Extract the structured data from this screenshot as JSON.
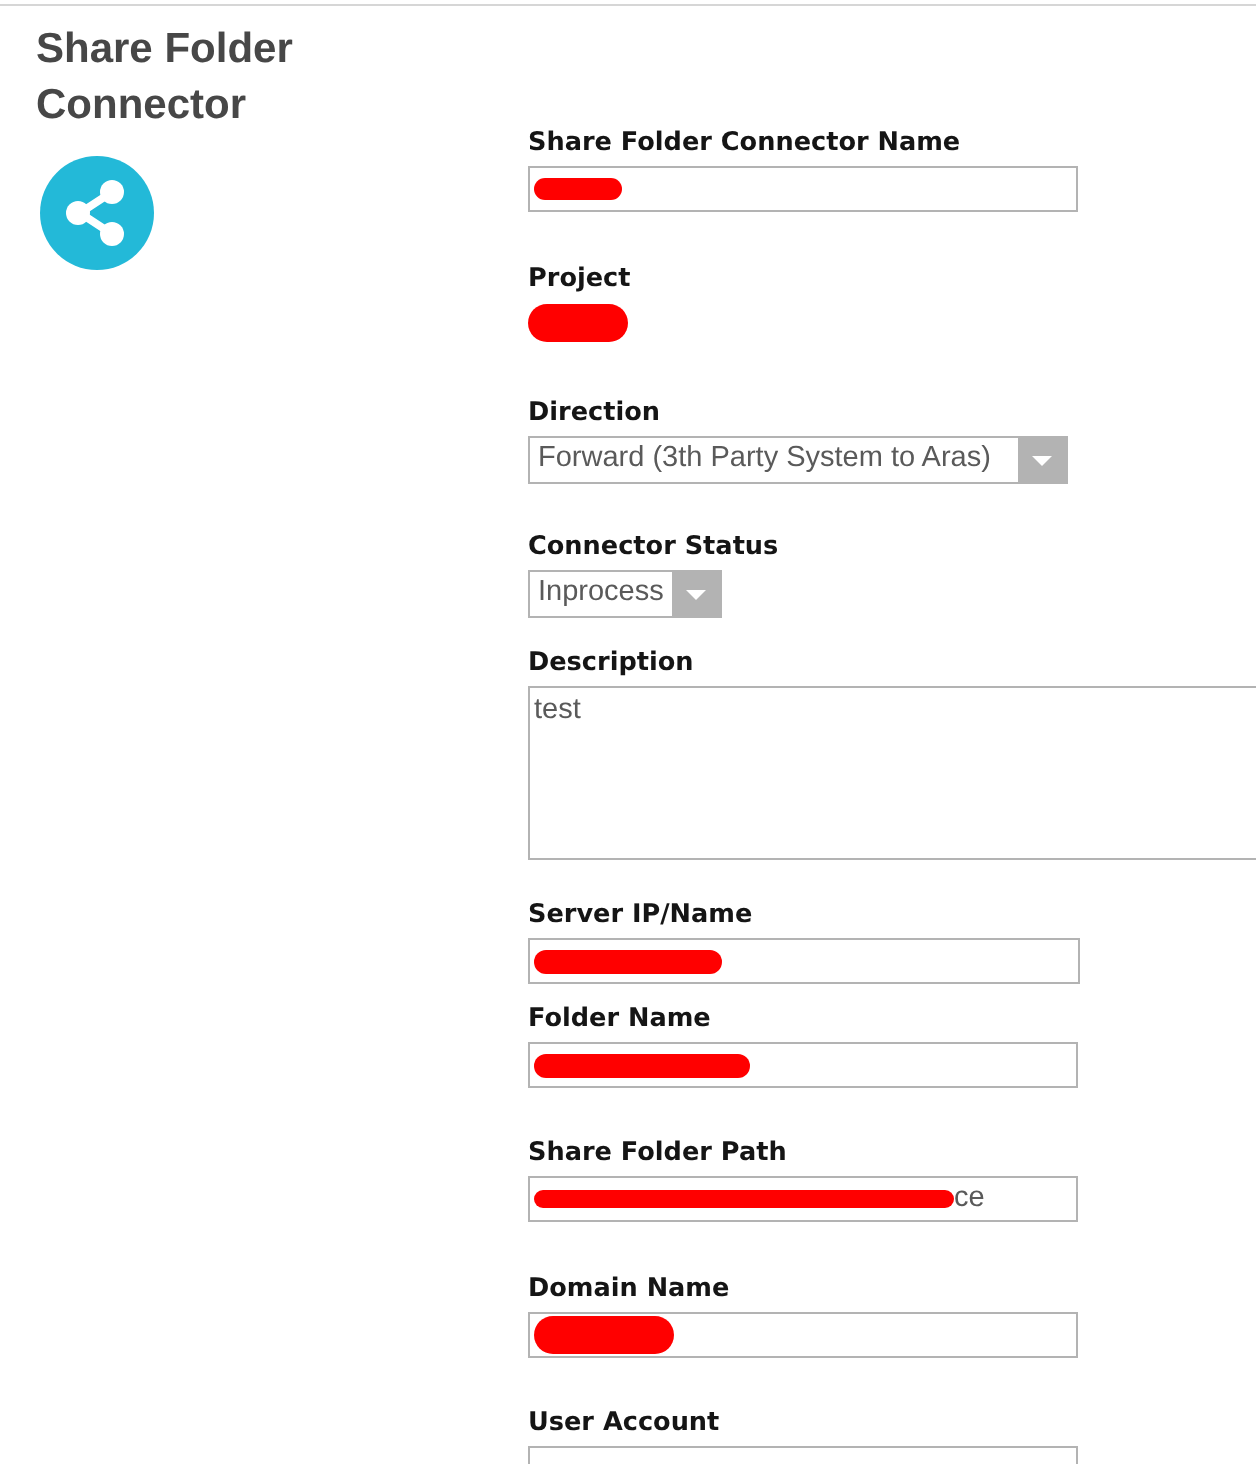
{
  "header": {
    "title": "Share Folder Connector"
  },
  "fields": [
    {
      "kind": "text",
      "label": "Share Folder Connector Name",
      "redacted": true
    },
    {
      "kind": "link",
      "label": "Project",
      "redacted": true
    },
    {
      "kind": "select",
      "label": "Direction",
      "value": "Forward (3th Party System to Aras)",
      "redacted": false
    },
    {
      "kind": "select",
      "label": "Connector Status",
      "value": "Inprocess",
      "redacted": false
    },
    {
      "kind": "textarea",
      "label": "Description",
      "value": "test",
      "redacted": false
    },
    {
      "kind": "text",
      "label": "Server IP/Name",
      "redacted": true
    },
    {
      "kind": "text",
      "label": "Folder Name",
      "redacted": true
    },
    {
      "kind": "text",
      "label": "Share Folder Path",
      "value": "ce",
      "redacted": true
    },
    {
      "kind": "text",
      "label": "Domain Name",
      "redacted": true
    },
    {
      "kind": "text",
      "label": "User Account",
      "redacted": false
    }
  ]
}
